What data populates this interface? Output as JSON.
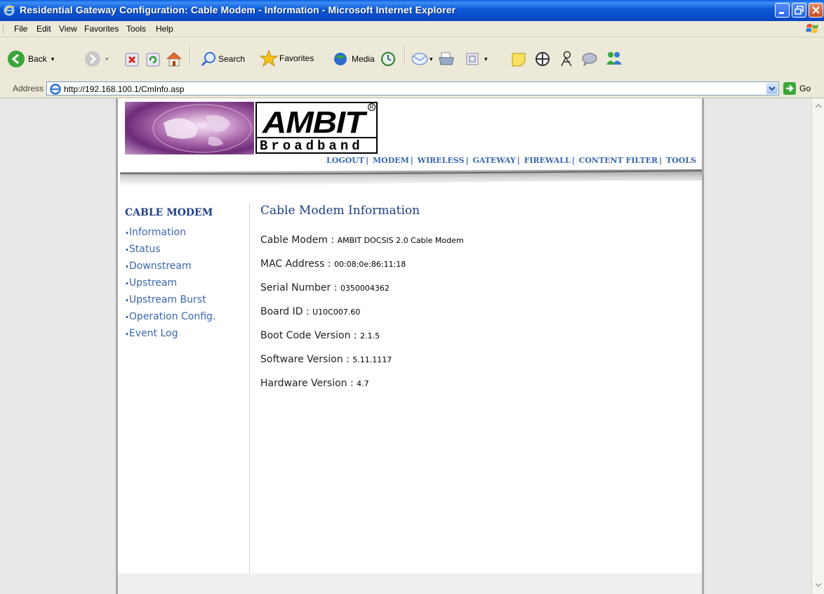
{
  "window": {
    "title": "Residential Gateway Configuration: Cable Modem - Information - Microsoft Internet Explorer"
  },
  "menu": {
    "items": [
      "File",
      "Edit",
      "View",
      "Favorites",
      "Tools",
      "Help"
    ]
  },
  "toolbar": {
    "back_label": "Back",
    "search_label": "Search",
    "favorites_label": "Favorites",
    "media_label": "Media"
  },
  "address": {
    "label": "Address",
    "url": "http://192.168.100.1/CmInfo.asp",
    "go_label": "Go"
  },
  "page": {
    "logo": {
      "brand": "AMBIT",
      "tagline": "Broadband",
      "registered": "R"
    },
    "topnav": [
      "LOGOUT",
      "MODEM",
      "WIRELESS",
      "GATEWAY",
      "FIREWALL",
      "CONTENT FILTER",
      "TOOLS"
    ],
    "sidebar": {
      "heading": "CABLE MODEM",
      "links": [
        "Information",
        "Status",
        "Downstream",
        "Upstream",
        "Upstream Burst",
        "Operation Config.",
        "Event Log"
      ]
    },
    "content": {
      "heading": "Cable Modem Information",
      "rows": [
        {
          "label": "Cable Modem :",
          "value": "AMBIT DOCSIS 2.0 Cable Modem"
        },
        {
          "label": "MAC Address :",
          "value": "00:08:0e:86:11:18"
        },
        {
          "label": "Serial Number :",
          "value": "0350004362"
        },
        {
          "label": "Board ID :",
          "value": "U10C007.60"
        },
        {
          "label": "Boot Code Version :",
          "value": "2.1.5"
        },
        {
          "label": "Software Version :",
          "value": "5.11.1117"
        },
        {
          "label": "Hardware Version :",
          "value": "4.7"
        }
      ]
    }
  },
  "colors": {
    "titlebar": "#0b57d6",
    "heading": "#1e3f8a",
    "link": "#3a66b0"
  }
}
